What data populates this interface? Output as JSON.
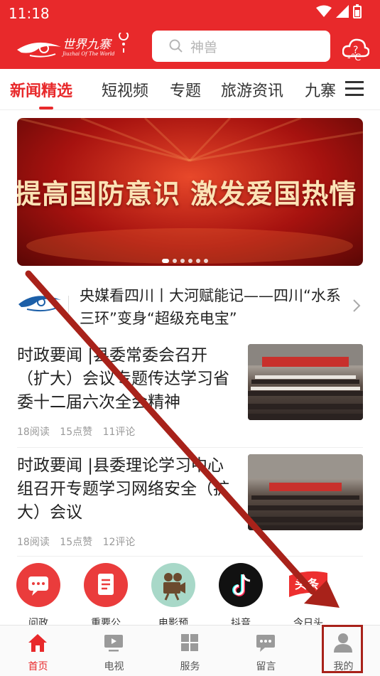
{
  "status_bar": {
    "time": "11:18"
  },
  "header": {
    "logo_text": "世界九寨",
    "logo_subtitle": "Jiuzhai Of The World",
    "search_placeholder": "神兽",
    "weather_temp": "-℃"
  },
  "tabs": [
    {
      "label": "新闻精选",
      "active": true
    },
    {
      "label": "短视频"
    },
    {
      "label": "专题"
    },
    {
      "label": "旅游资讯"
    },
    {
      "label": "九寨"
    }
  ],
  "banner": {
    "text": "提高国防意识 激发爱国热情",
    "slide_count": 6,
    "active_slide": 1
  },
  "ticker": {
    "text": "央媒看四川丨大河赋能记——四川“水系三环”变身“超级充电宝”"
  },
  "articles": [
    {
      "title": "时政要闻 |县委常委会召开（扩大）会议专题传达学习省委十二届六次全会精神",
      "reads": "18阅读",
      "likes": "15点赞",
      "comments": "11评论"
    },
    {
      "title": "时政要闻 |县委理论学习中心组召开专题学习网络安全（扩大）会议",
      "reads": "18阅读",
      "likes": "15点赞",
      "comments": "12评论"
    }
  ],
  "quick_icons": [
    {
      "label": "问政",
      "icon": "chat-bubble-icon"
    },
    {
      "label": "重要公",
      "icon": "document-icon"
    },
    {
      "label": "电影预",
      "icon": "film-camera-icon"
    },
    {
      "label": "抖音",
      "icon": "tiktok-icon"
    },
    {
      "label": "今日头",
      "icon": "toutiao-icon"
    }
  ],
  "bottom_nav": [
    {
      "label": "首页",
      "icon": "home-icon",
      "active": true
    },
    {
      "label": "电视",
      "icon": "tv-icon"
    },
    {
      "label": "服务",
      "icon": "grid-icon"
    },
    {
      "label": "留言",
      "icon": "message-icon"
    },
    {
      "label": "我的",
      "icon": "user-icon"
    }
  ],
  "colors": {
    "brand": "#e8292b",
    "annotation": "#a8221a"
  }
}
